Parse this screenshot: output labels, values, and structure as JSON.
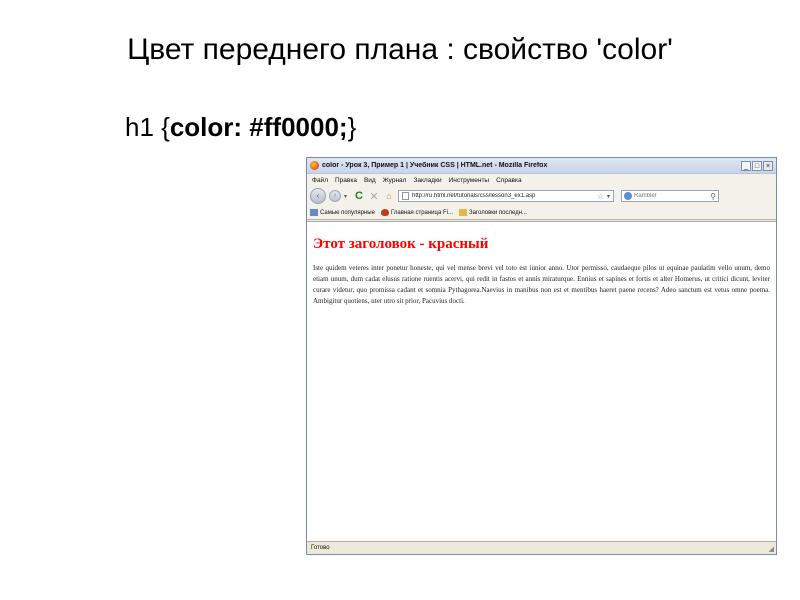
{
  "slide": {
    "title": "Цвет переднего плана : свойство 'color'",
    "code": {
      "selector": "h1 ",
      "open_brace": "{",
      "declaration": "color: #ff0000;",
      "close_brace": "}"
    }
  },
  "browser": {
    "window_title": "color - Урок 3, Пример 1 | Учебник CSS | HTML.net - Mozilla Firefox",
    "window_buttons": {
      "minimize": "_",
      "maximize": "□",
      "close": "×"
    },
    "menu": [
      "Файл",
      "Правка",
      "Вид",
      "Журнал",
      "Закладки",
      "Инструменты",
      "Справка"
    ],
    "nav": {
      "back": "‹",
      "forward": "›",
      "dropdown": "▾",
      "reload": "C",
      "stop": "✕",
      "home": "⌂"
    },
    "url": "http://ru.html.net/tutorials/css/lesson3_ex1.asp",
    "url_star": "☆",
    "url_dropdown": "▾",
    "search_placeholder": "Rambler",
    "search_icon": "⚲",
    "bookmarks": [
      "Самые популярные",
      "Главная страница Fi...",
      "Заголовки последн..."
    ],
    "status": "Готово",
    "resize_grip": "◢"
  },
  "page_content": {
    "heading": "Этот заголовок - красный",
    "paragraph": "Iste quidem veteres inter ponetur honeste, qui vel mense brevi vel toto est iunior anno. Utor permisso, caudaeque pilos ut equinae paulatim vello unum, demo etiam unum, dum cadat elusus ratione ruentis acervi, qui redit in fastos et annis miraturque. Ennius et sapines et fortis et alter Homerus, ut critici dicunt, leviter curare videtur, quo promissa cadant et somnia Pythagorea.Naevius in manibus non est et mentibus haeret paene recens? Adeo sanctum est vetus omne poema. Ambigitur quotiens, uter utro sit prior, Pacuvius docti.",
    "heading_color": "#ff0000"
  },
  "icons": {
    "app": "firefox-icon",
    "page": "page-icon",
    "search_engine": "rambler-icon",
    "bookmark_1": "bookmarks-folder-icon",
    "bookmark_2": "firefox-homepage-icon",
    "bookmark_3": "rss-feed-icon"
  }
}
